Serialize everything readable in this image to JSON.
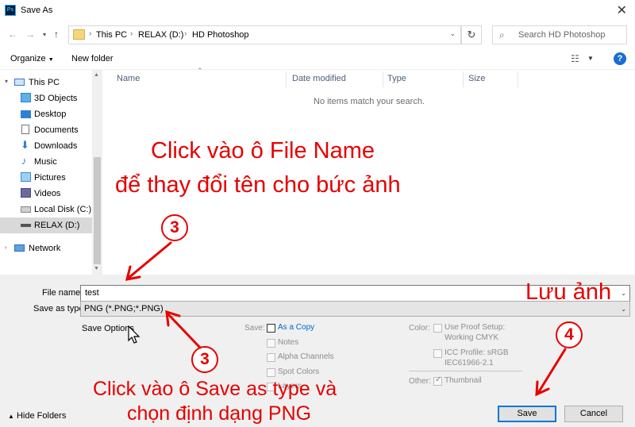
{
  "window": {
    "title": "Save As",
    "app_icon": "Ps"
  },
  "address": {
    "crumbs": [
      "This PC",
      "RELAX (D:)",
      "HD Photoshop"
    ],
    "search_placeholder": "Search HD Photoshop"
  },
  "toolbar": {
    "organize": "Organize",
    "new_folder": "New folder",
    "help": "?"
  },
  "nav": {
    "items": [
      {
        "label": "This PC",
        "icon": "computer-icon"
      },
      {
        "label": "3D Objects",
        "icon": "3d-objects-icon"
      },
      {
        "label": "Desktop",
        "icon": "desktop-icon"
      },
      {
        "label": "Documents",
        "icon": "documents-icon"
      },
      {
        "label": "Downloads",
        "icon": "downloads-icon"
      },
      {
        "label": "Music",
        "icon": "music-icon"
      },
      {
        "label": "Pictures",
        "icon": "pictures-icon"
      },
      {
        "label": "Videos",
        "icon": "videos-icon"
      },
      {
        "label": "Local Disk (C:)",
        "icon": "drive-icon"
      },
      {
        "label": "RELAX (D:)",
        "icon": "drive-icon",
        "selected": true
      },
      {
        "label": "Network",
        "icon": "network-icon"
      }
    ]
  },
  "filelist": {
    "columns": [
      "Name",
      "Date modified",
      "Type",
      "Size"
    ],
    "empty_message": "No items match your search."
  },
  "form": {
    "file_name_label": "File name:",
    "file_name_value": "test",
    "save_type_label": "Save as type:",
    "save_type_value": "PNG (*.PNG;*.PNG)"
  },
  "options": {
    "save_options_label": "Save Options",
    "save_label": "Save:",
    "as_copy": "As a Copy",
    "notes": "Notes",
    "alpha_channels": "Alpha Channels",
    "spot_colors": "Spot Colors",
    "layers": "Layers",
    "color_label": "Color:",
    "use_proof_1": "Use Proof Setup:",
    "use_proof_2": "Working CMYK",
    "icc_1": "ICC Profile:  sRGB",
    "icc_2": "IEC61966-2.1",
    "other_label": "Other:",
    "thumbnail": "Thumbnail"
  },
  "buttons": {
    "save": "Save",
    "cancel": "Cancel",
    "hide_folders": "Hide Folders"
  },
  "annotations": {
    "top_line1": "Click vào ô File Name",
    "top_line2": "để thay đổi tên cho bức ảnh",
    "badge_a": "3",
    "badge_b": "3",
    "badge_c": "4",
    "save_note": "Lưu ảnh",
    "bottom_line1": "Click vào ô Save as type và",
    "bottom_line2": "chọn định dạng PNG"
  },
  "colors": {
    "annotation": "#e60000",
    "accent": "#0078d7",
    "dialog_bg": "#f0f0f0"
  }
}
